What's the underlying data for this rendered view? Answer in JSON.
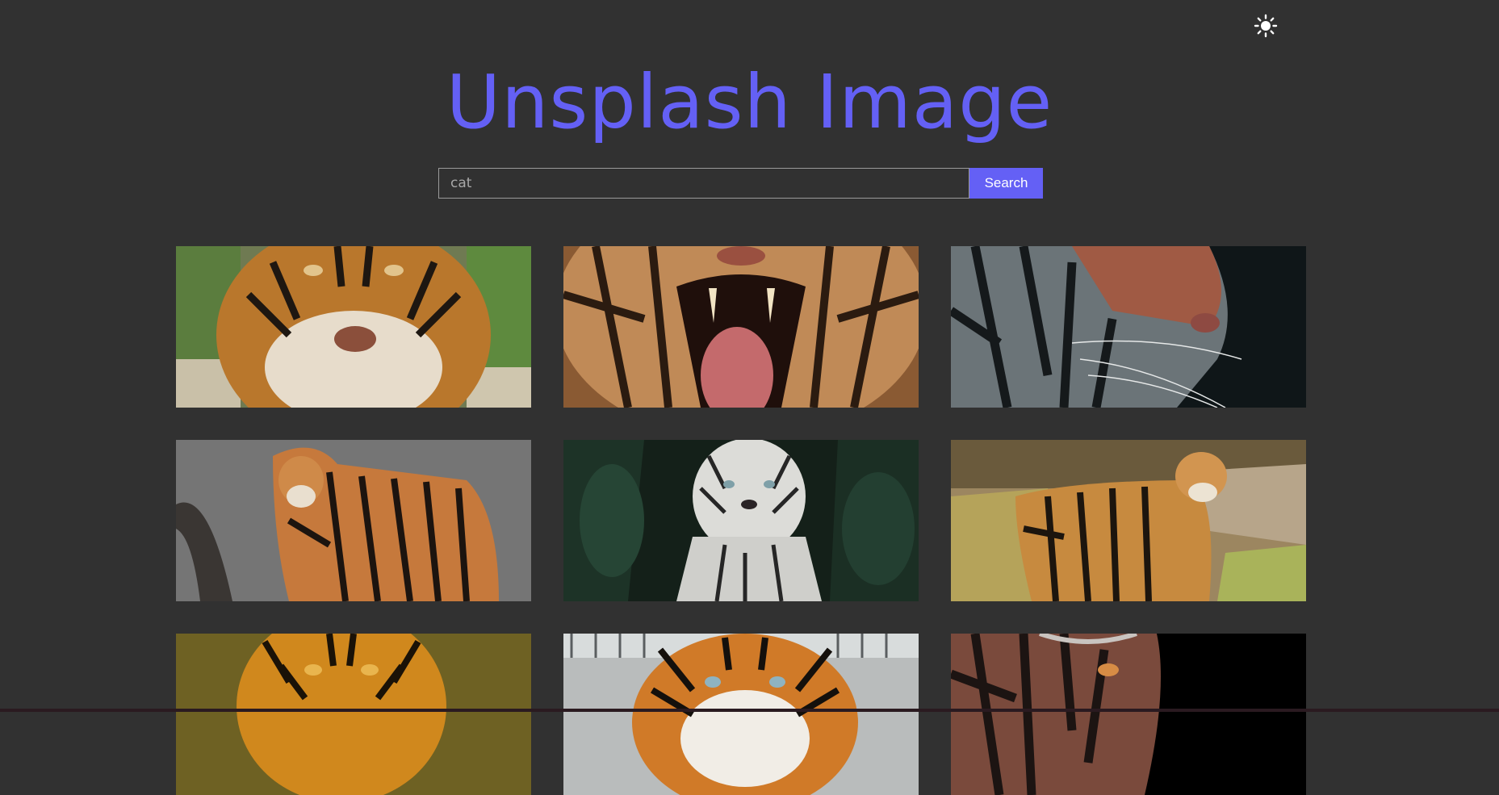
{
  "header": {
    "theme_toggle_icon": "sun-icon"
  },
  "hero": {
    "title": "Unsplash Image"
  },
  "search": {
    "value": "cat",
    "button_label": "Search"
  },
  "colors": {
    "accent": "#6460f5",
    "background": "#313131",
    "input_border": "#9a9a9a"
  },
  "gallery": {
    "images": [
      {
        "name": "tiger-face-closeup"
      },
      {
        "name": "tiger-roaring-mouth"
      },
      {
        "name": "tiger-profile-dark"
      },
      {
        "name": "tiger-standing-rock"
      },
      {
        "name": "white-tiger-jungle"
      },
      {
        "name": "tiger-standing-grass"
      },
      {
        "name": "tiger-face-golden"
      },
      {
        "name": "tiger-face-fence"
      },
      {
        "name": "tiger-face-shadow"
      }
    ]
  }
}
